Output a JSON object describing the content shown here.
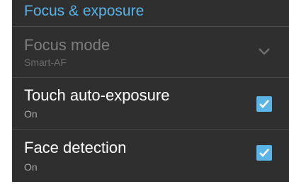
{
  "section": {
    "title": "Focus & exposure"
  },
  "rows": [
    {
      "title": "Focus mode",
      "value": "Smart-AF",
      "control": "dropdown",
      "enabled": false
    },
    {
      "title": "Touch auto-exposure",
      "value": "On",
      "control": "checkbox",
      "checked": true
    },
    {
      "title": "Face detection",
      "value": "On",
      "control": "checkbox",
      "checked": true
    }
  ],
  "colors": {
    "accent": "#5ab4e6",
    "background": "#2f2f2f"
  },
  "icons": {
    "dropdown": "chevron-down-icon",
    "checkbox": "checkmark-icon"
  }
}
